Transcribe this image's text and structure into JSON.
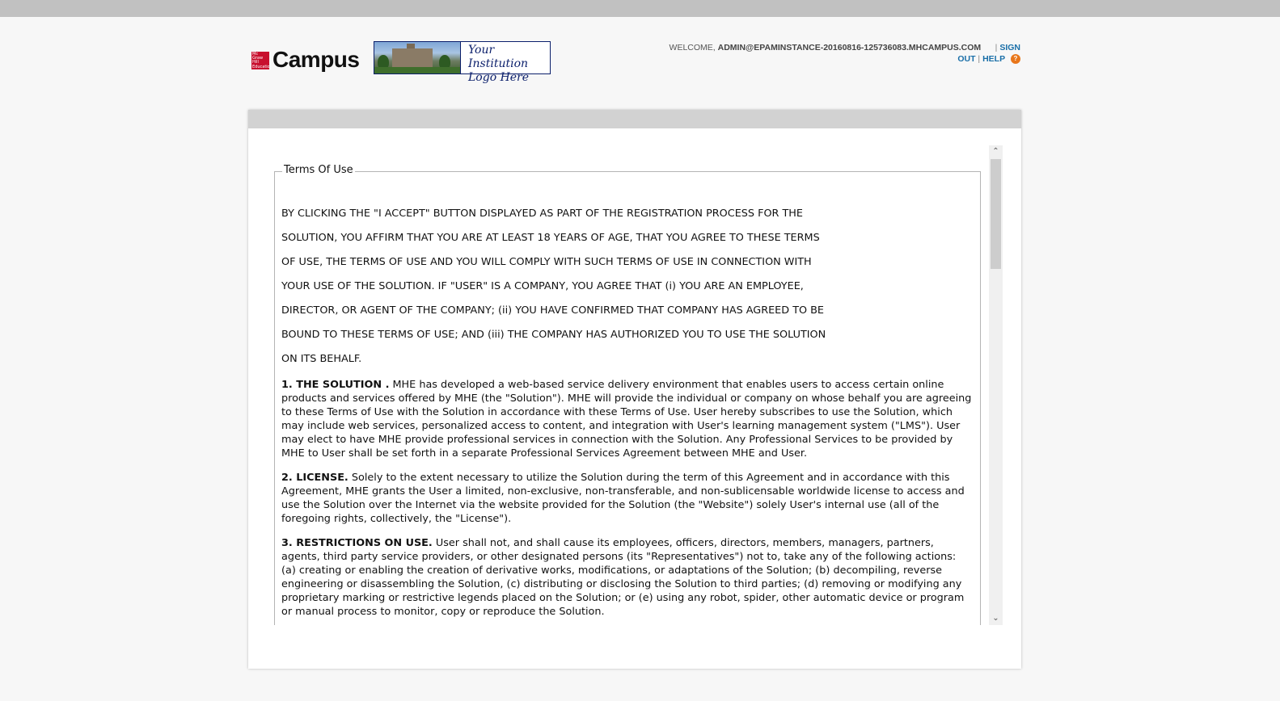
{
  "header": {
    "brand_mark_text": "Mc Graw Hill Education",
    "brand": "Campus",
    "institution_logo_line1": "Your Institution",
    "institution_logo_line2": "Logo Here",
    "welcome_label": "WELCOME,",
    "user_email": "ADMIN@EPAMINSTANCE-20160816-125736083.MHCAMPUS.COM",
    "signout_part1": "SIGN",
    "signout_part2": "OUT",
    "help_label": "HELP",
    "help_icon_glyph": "?"
  },
  "terms": {
    "legend": "Terms Of Use",
    "intro_lines": [
      "BY CLICKING THE \"I ACCEPT\" BUTTON DISPLAYED AS PART OF THE REGISTRATION PROCESS FOR THE",
      "SOLUTION, YOU AFFIRM THAT YOU ARE AT LEAST 18 YEARS OF AGE, THAT YOU AGREE TO THESE TERMS",
      "OF USE, THE TERMS OF USE AND YOU WILL COMPLY WITH SUCH TERMS OF USE IN CONNECTION WITH",
      "YOUR USE OF THE SOLUTION. IF \"USER\" IS A COMPANY, YOU AGREE THAT (i) YOU ARE AN EMPLOYEE,",
      "DIRECTOR, OR AGENT OF THE COMPANY; (ii) YOU HAVE CONFIRMED THAT COMPANY HAS AGREED TO BE",
      "BOUND TO THESE TERMS OF USE; AND (iii) THE COMPANY HAS AUTHORIZED YOU TO USE THE SOLUTION",
      "ON ITS BEHALF."
    ],
    "sections": [
      {
        "heading": "1. THE SOLUTION .",
        "body": "MHE has developed a web-based service delivery environment that enables users to access certain online products and services offered by MHE (the \"Solution\"). MHE will provide the individual or company on whose behalf you are agreeing to these Terms of Use with the Solution in accordance with these Terms of Use. User hereby subscribes to use the Solution, which may include web services, personalized access to content, and integration with User's learning management system (\"LMS\"). User may elect to have MHE provide professional services in connection with the Solution. Any Professional Services to be provided by MHE to User shall be set forth in a separate Professional Services Agreement between MHE and User."
      },
      {
        "heading": "2. LICENSE.",
        "body": "Solely to the extent necessary to utilize the Solution during the term of this Agreement and in accordance with this Agreement, MHE grants the User a limited, non-exclusive, non-transferable, and non-sublicensable worldwide license to access and use the Solution over the Internet via the website provided for the Solution (the \"Website\") solely User's internal use (all of the foregoing rights, collectively, the \"License\")."
      },
      {
        "heading": "3. RESTRICTIONS ON USE.",
        "body": "User shall not, and shall cause its employees, officers, directors, members, managers, partners, agents, third party service providers, or other designated persons (its \"Representatives\") not to, take any of the following actions: (a) creating or enabling the creation of derivative works, modifications, or adaptations of the Solution; (b) decompiling, reverse engineering or disassembling the Solution, (c) distributing or disclosing the Solution to third parties; (d) removing or modifying any proprietary marking or restrictive legends placed on the Solution; or (e) using any robot, spider, other automatic device or program or manual process to monitor, copy or reproduce the Solution."
      }
    ]
  },
  "scrollbar": {
    "up_glyph": "⌃",
    "down_glyph": "⌄"
  }
}
